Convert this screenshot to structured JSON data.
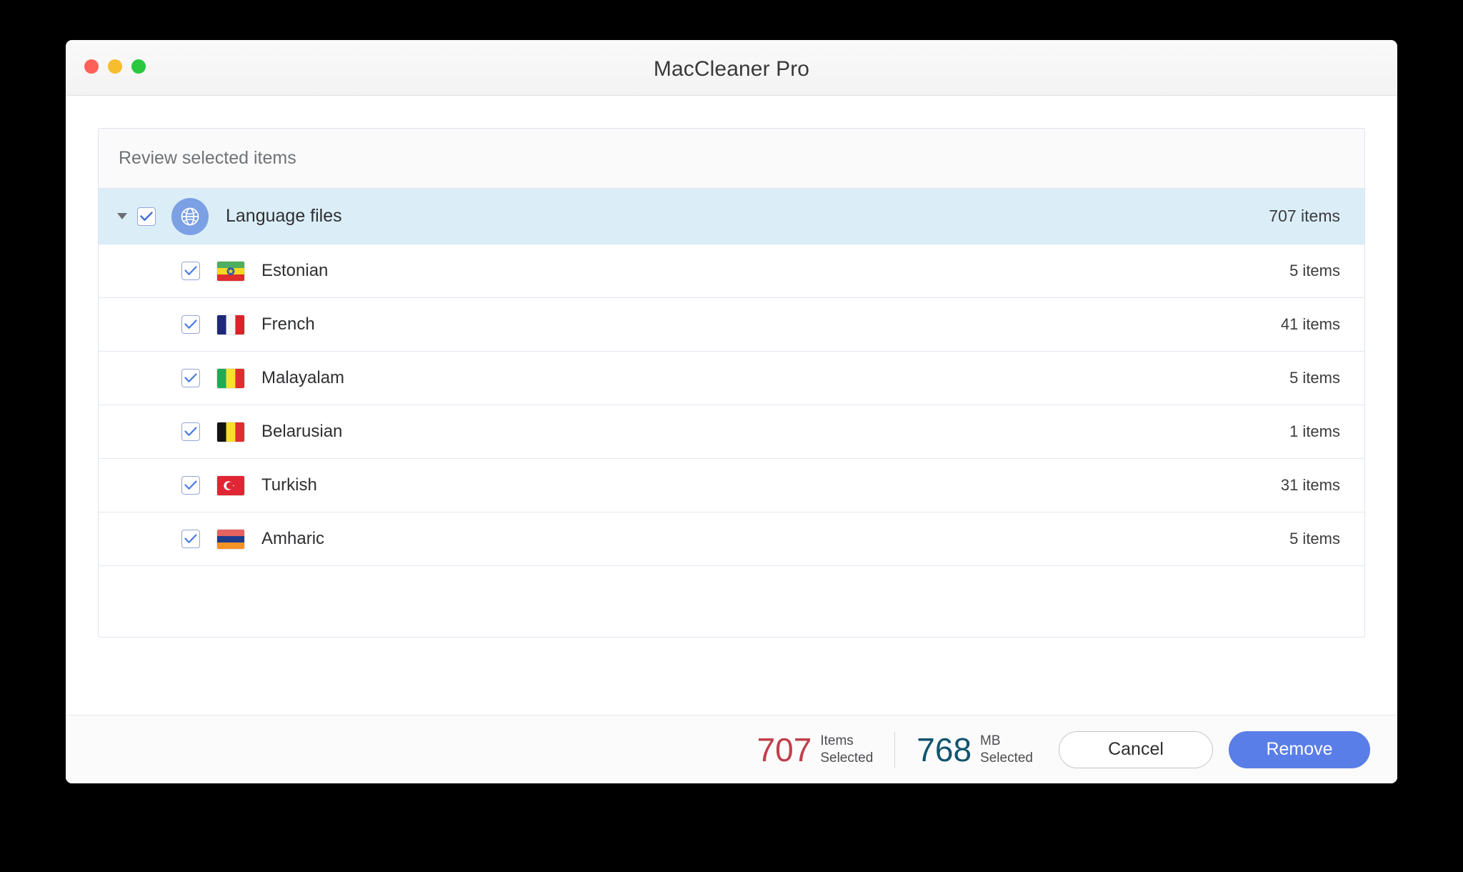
{
  "window": {
    "title": "MacCleaner Pro",
    "traffic_lights": [
      {
        "name": "close",
        "color": "#ff6159"
      },
      {
        "name": "minimize",
        "color": "#f7bd2e"
      },
      {
        "name": "zoom",
        "color": "#29c83f"
      }
    ]
  },
  "panel": {
    "header_title": "Review selected items",
    "group": {
      "label": "Language files",
      "count": "707 items",
      "icon": "globe-icon",
      "checked": true,
      "expanded": true
    },
    "items": [
      {
        "label": "Estonian",
        "count": "5 items",
        "checked": true,
        "flag": "ethiopia-flag-icon"
      },
      {
        "label": "French",
        "count": "41 items",
        "checked": true,
        "flag": "france-flag-icon"
      },
      {
        "label": "Malayalam",
        "count": "5 items",
        "checked": true,
        "flag": "mali-flag-icon"
      },
      {
        "label": "Belarusian",
        "count": "1 items",
        "checked": true,
        "flag": "belgium-flag-icon"
      },
      {
        "label": "Turkish",
        "count": "31 items",
        "checked": true,
        "flag": "turkey-flag-icon"
      },
      {
        "label": "Amharic",
        "count": "5 items",
        "checked": true,
        "flag": "armenia-flag-icon"
      }
    ]
  },
  "footer": {
    "items_selected_value": "707",
    "items_selected_label_line1": "Items",
    "items_selected_label_line2": "Selected",
    "size_selected_value": "768",
    "size_selected_label_line1": "MB",
    "size_selected_label_line2": "Selected",
    "cancel_label": "Cancel",
    "remove_label": "Remove"
  },
  "colors": {
    "accent": "#5a7ee8",
    "group_highlight": "#dbeef8",
    "items_stat": "#c0404a",
    "size_stat": "#115470"
  }
}
